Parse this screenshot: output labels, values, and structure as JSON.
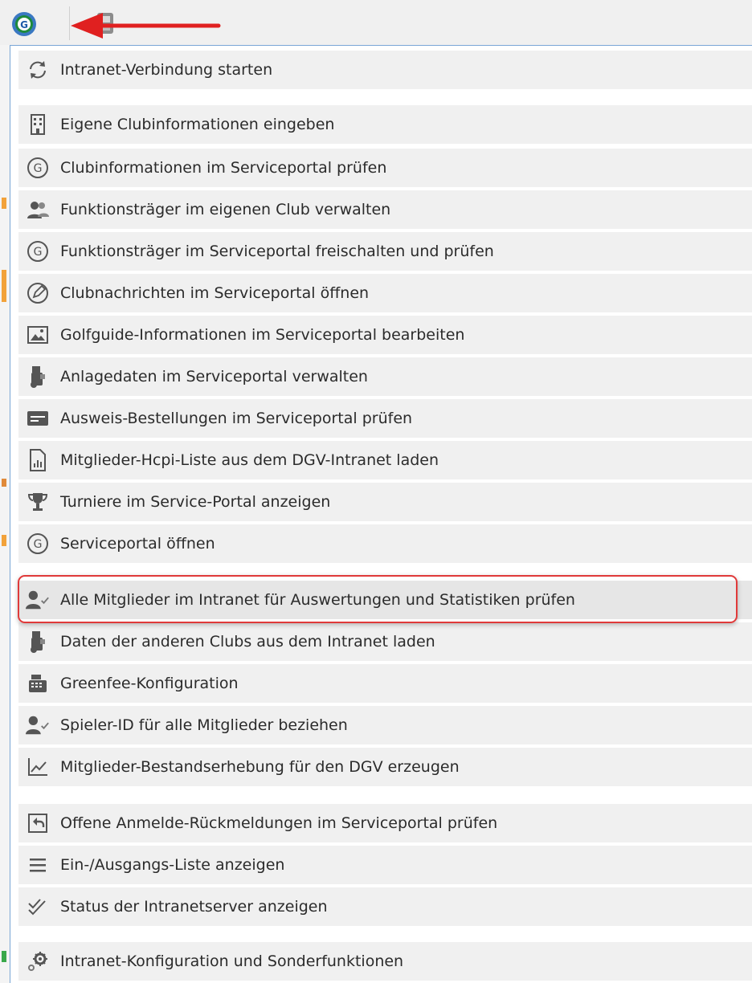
{
  "toolbar": {
    "logo_icon": "golf-g-logo-icon",
    "secondary_icon": "plug-icon",
    "arrow_color": "#e02020"
  },
  "menu": {
    "border_color": "#7aa6d6",
    "highlight_color": "#e03a3a",
    "items": [
      {
        "label": "Intranet-Verbindung starten",
        "icon": "refresh-icon"
      },
      {
        "label": "Eigene Clubinformationen eingeben",
        "icon": "building-icon"
      },
      {
        "label": "Clubinformationen im Serviceportal prüfen",
        "icon": "g-circle-icon"
      },
      {
        "label": "Funktionsträger im eigenen Club verwalten",
        "icon": "users-icon"
      },
      {
        "label": "Funktionsträger im Serviceportal freischalten und prüfen",
        "icon": "g-circle-icon"
      },
      {
        "label": "Clubnachrichten im Serviceportal öffnen",
        "icon": "edit-circle-icon"
      },
      {
        "label": "Golfguide-Informationen im Serviceportal bearbeiten",
        "icon": "image-icon"
      },
      {
        "label": "Anlagedaten im Serviceportal verwalten",
        "icon": "golf-bag-icon"
      },
      {
        "label": "Ausweis-Bestellungen im Serviceportal prüfen",
        "icon": "card-icon"
      },
      {
        "label": "Mitglieder-Hcpi-Liste aus dem DGV-Intranet laden",
        "icon": "chart-document-icon"
      },
      {
        "label": "Turniere im Service-Portal anzeigen",
        "icon": "trophy-icon"
      },
      {
        "label": "Serviceportal öffnen",
        "icon": "g-circle-icon"
      },
      {
        "label": "Alle Mitglieder im Intranet für Auswertungen und Statistiken prüfen",
        "icon": "user-check-icon"
      },
      {
        "label": "Daten der anderen Clubs aus dem Intranet laden",
        "icon": "golf-bag-icon"
      },
      {
        "label": "Greenfee-Konfiguration",
        "icon": "cash-register-icon"
      },
      {
        "label": "Spieler-ID für alle Mitglieder beziehen",
        "icon": "user-check-icon"
      },
      {
        "label": "Mitglieder-Bestandserhebung für den DGV erzeugen",
        "icon": "line-chart-icon"
      },
      {
        "label": "Offene Anmelde-Rückmeldungen im Serviceportal prüfen",
        "icon": "reply-icon"
      },
      {
        "label": "Ein-/Ausgangs-Liste anzeigen",
        "icon": "list-icon"
      },
      {
        "label": "Status der Intranetserver anzeigen",
        "icon": "double-check-icon"
      },
      {
        "label": "Intranet-Konfiguration und Sonderfunktionen",
        "icon": "gears-icon"
      }
    ]
  }
}
